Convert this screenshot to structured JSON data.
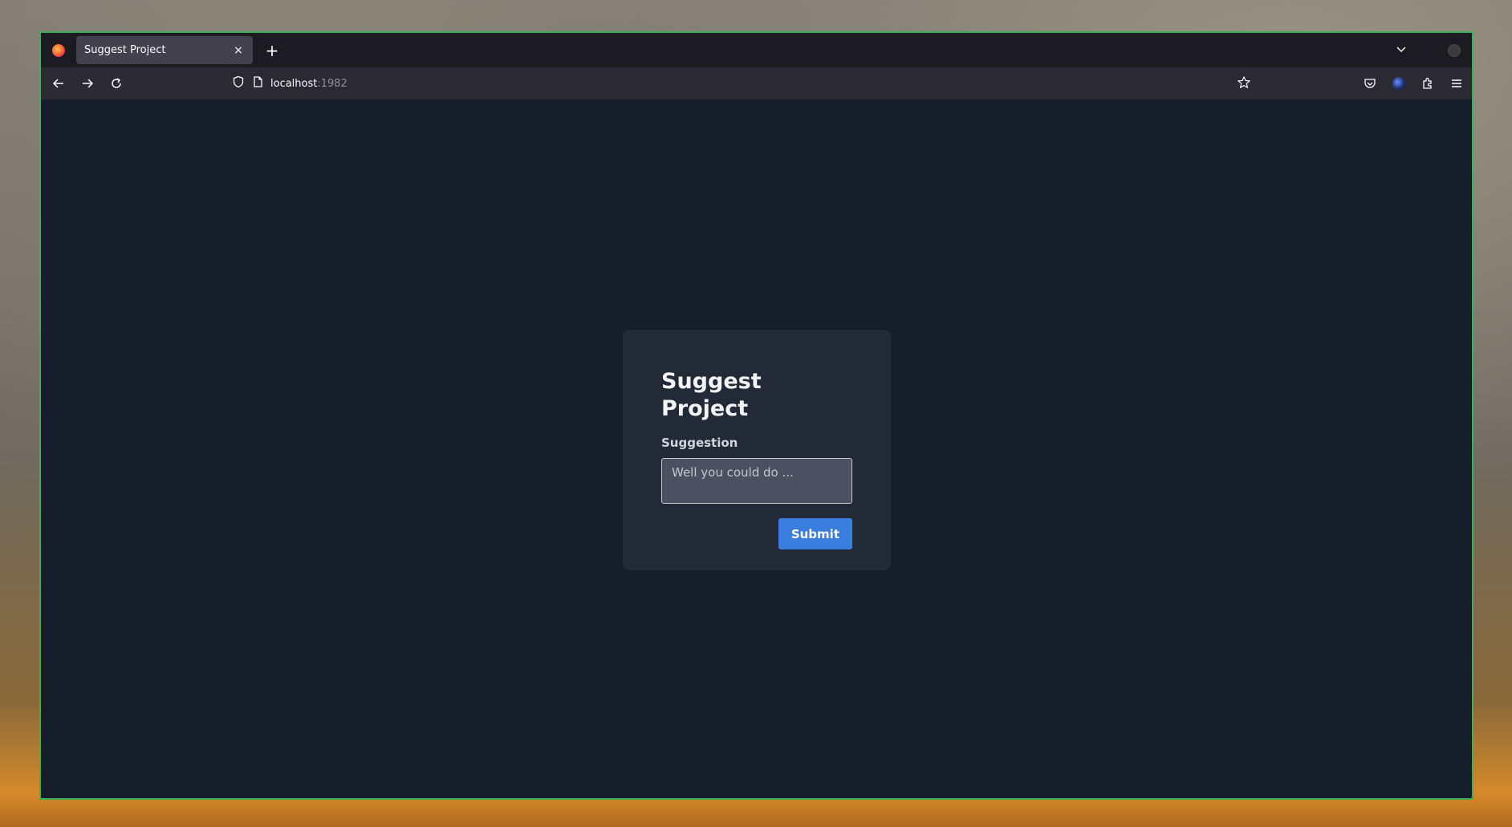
{
  "tab": {
    "title": "Suggest Project",
    "close_glyph": "×",
    "new_tab_glyph": "+"
  },
  "toolbar": {
    "list_tabs_glyph": "⌄",
    "url_host": "localhost",
    "url_port": ":1982"
  },
  "form": {
    "heading": "Suggest Project",
    "field_label": "Suggestion",
    "placeholder": "Well you could do ...",
    "submit_label": "Submit"
  },
  "colors": {
    "page_background": "#161d2b",
    "card_background": "#232a37",
    "accent": "#3b7ddd",
    "window_border": "#3fae5a"
  },
  "icons": [
    "firefox-logo-icon",
    "close-icon",
    "plus-icon",
    "chevron-down-icon",
    "back-arrow-icon",
    "forward-arrow-icon",
    "reload-icon",
    "shield-icon",
    "page-icon",
    "star-icon",
    "pocket-icon",
    "profile-icon",
    "extensions-icon",
    "menu-icon"
  ]
}
